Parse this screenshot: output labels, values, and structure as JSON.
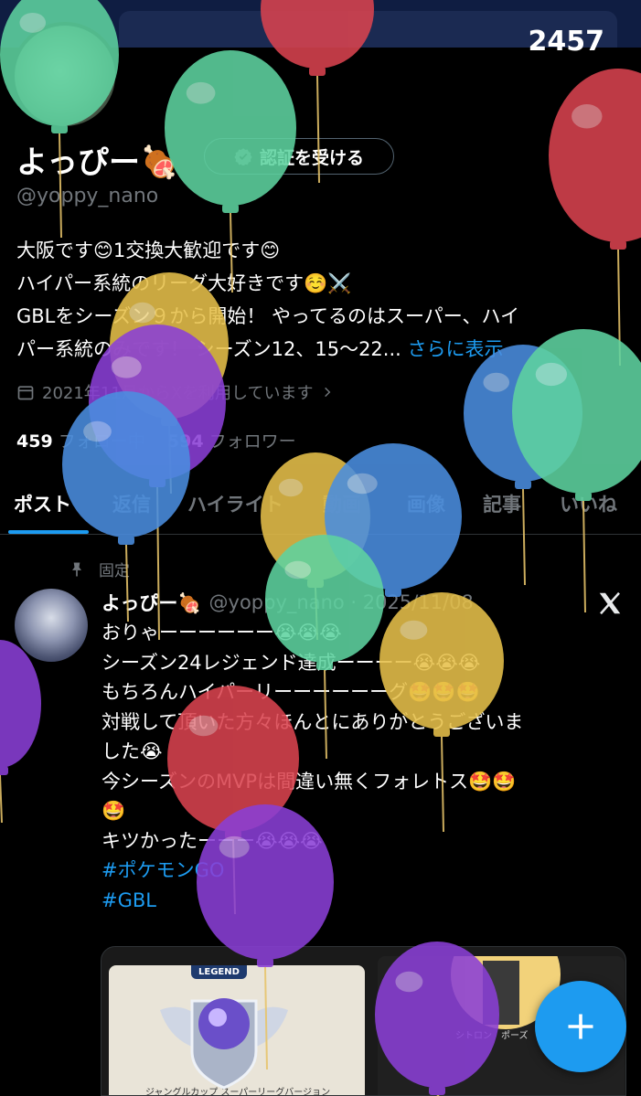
{
  "banner": {
    "score": "2457"
  },
  "profile": {
    "name": "よっぴー🍖",
    "verify_label": "認証を受ける",
    "handle": "@yoppy_nano",
    "bio_lines": [
      "大阪です😊1交換大歓迎です😊",
      "ハイパー系統のリーグ大好きです☺️⚔️",
      "GBLをシーズン９から開始！ やってるのはスーパー、ハイ",
      "パー系統のみです！ シーズン12、15～22..."
    ],
    "bio_more": "さらに表示",
    "joined": "2021年11月からXを利用しています",
    "following_count": "459",
    "following_label": "フォロー中",
    "followers_count": "594",
    "followers_label": "フォロワー"
  },
  "tabs": [
    "ポスト",
    "返信",
    "ハイライト",
    "動画",
    "画像",
    "記事",
    "いいね"
  ],
  "post": {
    "pinned_label": "固定",
    "author": "よっぴー🍖",
    "meta": "@yoppy_nano · 2025/11/08",
    "lines": [
      "おりゃーーーーーー😭😭😭",
      "シーズン24レジェンド達成ーーーー😭😭😭",
      "もちろんハイパーリーーーーーーグ🤩🤩🤩",
      "対戦して頂いた方々ほんとにありがとうございま",
      "した😭",
      "今シーズンのMVPは間違い無くフォレトス🤩🤩",
      "🤩",
      "キツかったーーー😭😭😭"
    ],
    "hashtags": [
      "#ポケモンGO",
      "#GBL"
    ],
    "media_left_label": "LEGEND",
    "media_left_caption": "ジャングルカップ スーパーリーグバージョン",
    "media_right_text": "シトロン　ポーズ"
  },
  "colors": {
    "accent": "#1d9bf0",
    "background": "#000000",
    "muted": "#71767b",
    "balloon_green": "#5ed3a0",
    "balloon_red": "#d9434f",
    "balloon_yellow": "#e6c04a",
    "balloon_blue": "#4a8ee0",
    "balloon_purple": "#8a3fd6"
  }
}
